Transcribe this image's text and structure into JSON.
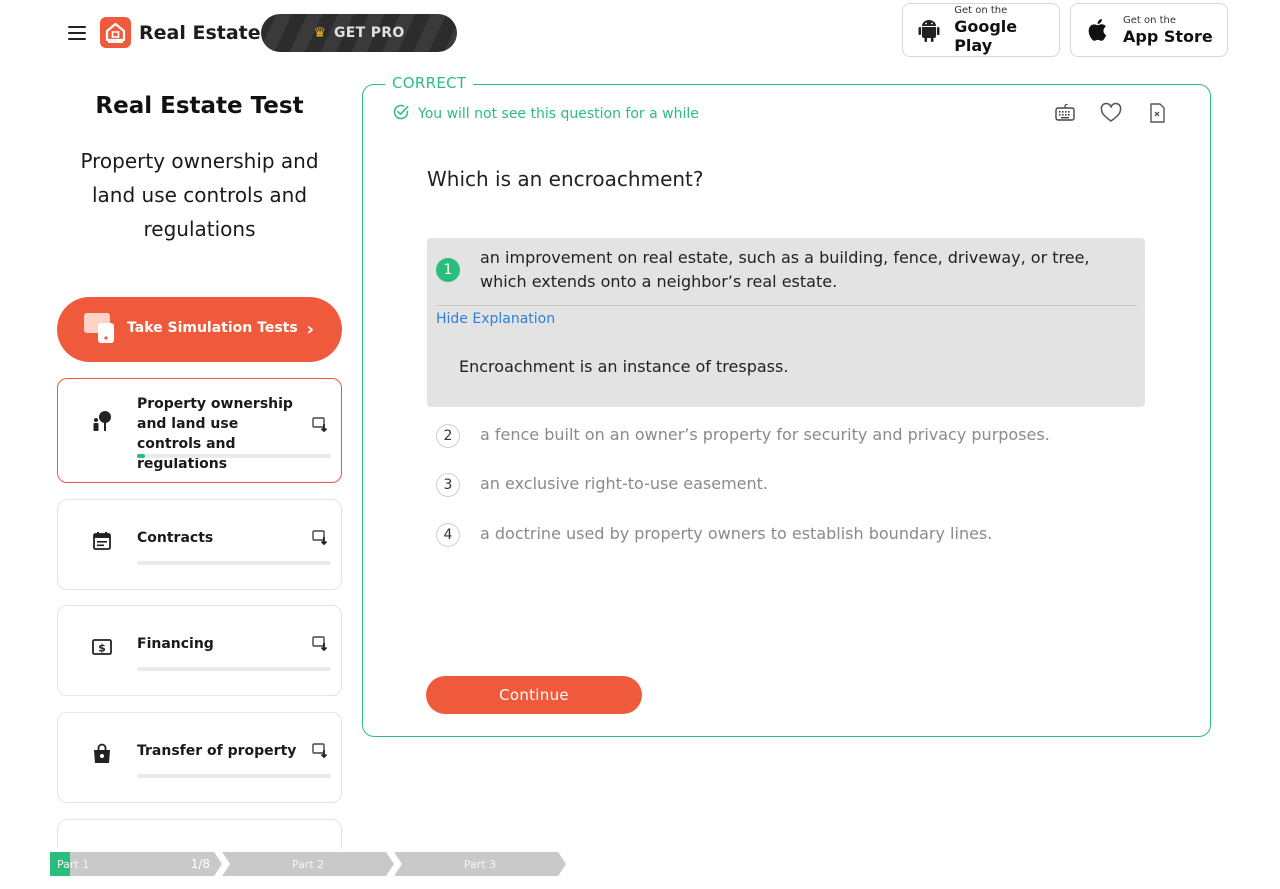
{
  "header": {
    "brand": "Real Estate",
    "get_pro_label": "GET PRO",
    "google_play": {
      "small": "Get on the",
      "big": "Google Play"
    },
    "app_store": {
      "small": "Get on the",
      "big": "App Store"
    }
  },
  "sidebar": {
    "title": "Real Estate Test",
    "subtitle": "Property ownership and land use controls and regulations",
    "simulation_button": "Take Simulation Tests",
    "topics": [
      {
        "label": "Property ownership and land use controls and regulations",
        "progress": 0.04,
        "active": true
      },
      {
        "label": "Contracts",
        "progress": 0,
        "active": false
      },
      {
        "label": "Financing",
        "progress": 0,
        "active": false
      },
      {
        "label": "Transfer of property",
        "progress": 0,
        "active": false
      }
    ],
    "parts": [
      {
        "label": "Part 1",
        "count": "1/8"
      },
      {
        "label": "Part 2"
      },
      {
        "label": "Part 3"
      }
    ]
  },
  "question": {
    "status": "CORRECT",
    "status_message": "You will not see this question for a while",
    "text": "Which is an encroachment?",
    "answers": [
      {
        "number": "1",
        "text": "an improvement on real estate, such as a building, fence, driveway, or tree, which extends onto a neighbor’s real estate.",
        "correct": true
      },
      {
        "number": "2",
        "text": "a fence built on an owner’s property for security and privacy purposes."
      },
      {
        "number": "3",
        "text": "an exclusive right-to-use easement."
      },
      {
        "number": "4",
        "text": "a doctrine used by property owners to establish boundary lines."
      }
    ],
    "hide_explanation_label": "Hide Explanation",
    "explanation": "Encroachment is an instance of trespass.",
    "continue_label": "Continue"
  },
  "colors": {
    "accent": "#f05a3c",
    "correct": "#2bbd7e",
    "link": "#2f7fd8"
  }
}
